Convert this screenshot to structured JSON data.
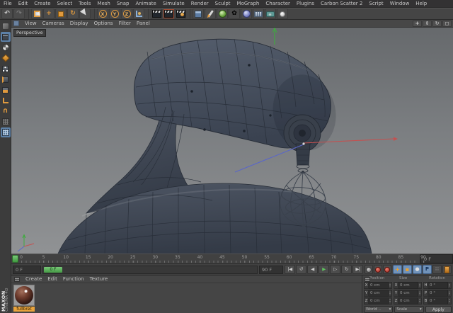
{
  "colors": {
    "accent_orange": "#E09A3E",
    "selection_blue": "#6D8FB5",
    "viewport_top": "#66696C",
    "viewport_bottom": "#909294",
    "model_fill": "#3E4652",
    "wireframe": "#272D37",
    "axis_x_red": "#C45050",
    "axis_y_green": "#3FAA3F",
    "axis_z_blue": "#5A66C8",
    "timeline_green": "#57A957",
    "material_label_orange": "#E8A33C"
  },
  "menu_bar": {
    "items": [
      "File",
      "Edit",
      "Create",
      "Select",
      "Tools",
      "Mesh",
      "Snap",
      "Animate",
      "Simulate",
      "Render",
      "Sculpt",
      "MoGraph",
      "Character",
      "Plugins",
      "Carbon Scatter 2",
      "Script",
      "Window",
      "Help"
    ]
  },
  "toolbar": {
    "items": [
      {
        "n": "undo-button",
        "g": "↶",
        "cls": "ic-light ic-b"
      },
      {
        "n": "redo-button",
        "g": "↷",
        "cls": "ic-dim ic-b"
      },
      {
        "sep": true
      },
      {
        "n": "live-selection-tool",
        "s": "sel"
      },
      {
        "n": "move-tool",
        "g": "+",
        "cls": "ic-orange ic-b"
      },
      {
        "n": "scale-tool",
        "s": "scale"
      },
      {
        "n": "rotate-tool",
        "g": "↻",
        "cls": "ic-orange ic-b"
      },
      {
        "n": "last-used-tool",
        "s": "cursor"
      },
      {
        "sep": true
      },
      {
        "n": "lock-x-axis-button",
        "s": "chip",
        "t": "X"
      },
      {
        "n": "lock-y-axis-button",
        "s": "chip",
        "t": "Y"
      },
      {
        "n": "lock-z-axis-button",
        "s": "chip",
        "t": "Z"
      },
      {
        "n": "coordinate-system-button",
        "s": "coordsys"
      },
      {
        "sep": true
      },
      {
        "n": "render-view-button",
        "s": "clap"
      },
      {
        "n": "render-active-view-button",
        "s": "clap s-clap-act"
      },
      {
        "n": "render-settings-button",
        "s": "clap s-clap-ball"
      },
      {
        "sep": true
      },
      {
        "n": "add-primitive-button",
        "s": "cube3d"
      },
      {
        "n": "add-spline-button",
        "s": "pen"
      },
      {
        "n": "add-generator-button",
        "s": "ballgreen"
      },
      {
        "n": "add-deformer-button",
        "g": "✿",
        "cls": "ic-b"
      },
      {
        "n": "add-environment-button",
        "s": "ballblue"
      },
      {
        "n": "add-floor-button",
        "s": "floor"
      },
      {
        "n": "add-camera-button",
        "s": "cam"
      },
      {
        "n": "add-light-button",
        "s": "bulb"
      }
    ]
  },
  "left_toolbar": {
    "items": [
      {
        "n": "make-editable-button",
        "s": "editable"
      },
      {
        "n": "model-mode-button",
        "s": "cube-dark",
        "active": true
      },
      {
        "n": "texture-mode-button",
        "s": "ball-check"
      },
      {
        "n": "workplane-mode-button",
        "s": "diamond"
      },
      {
        "n": "points-mode-button",
        "s": "cube-points"
      },
      {
        "n": "edges-mode-button",
        "s": "cube-edge"
      },
      {
        "n": "polygons-mode-button",
        "s": "cube-face"
      },
      {
        "n": "enable-axis-button",
        "s": "axisl"
      },
      {
        "n": "soft-selection-button",
        "g": "∩",
        "cls": "ic-orange ic-b"
      },
      {
        "n": "snap-enable-button",
        "s": "grid-dark"
      },
      {
        "n": "workplane-snap-button",
        "s": "grid-blue",
        "active": true
      }
    ]
  },
  "viewport": {
    "menu": [
      "View",
      "Cameras",
      "Display",
      "Options",
      "Filter",
      "Panel"
    ],
    "view_label": "Perspective",
    "controls": [
      {
        "n": "pan-view-button",
        "g": "+",
        "cls": "ic-light ic-b"
      },
      {
        "n": "zoom-view-button",
        "g": "⇕",
        "cls": "ic-light"
      },
      {
        "n": "rotate-view-button",
        "g": "↻",
        "cls": "ic-light"
      },
      {
        "n": "toggle-view-button",
        "g": "◻",
        "cls": "ic-light"
      }
    ]
  },
  "timeline": {
    "ticks": [
      "0",
      "5",
      "10",
      "15",
      "20",
      "25",
      "30",
      "35",
      "40",
      "45",
      "50",
      "55",
      "60",
      "65",
      "70",
      "75",
      "80",
      "85",
      "90"
    ],
    "current_frame": "0 F",
    "range_start": "0 F",
    "range_end": "90 F",
    "handle_label": "0 F"
  },
  "transport": {
    "buttons": [
      {
        "n": "goto-start-button",
        "g": "|◀"
      },
      {
        "n": "play-to-previous-key-button",
        "g": "↺"
      },
      {
        "n": "previous-frame-button",
        "g": "◀"
      },
      {
        "n": "play-button",
        "g": "▶",
        "cls": "green"
      },
      {
        "n": "next-frame-button",
        "g": "▷"
      },
      {
        "n": "play-to-next-key-button",
        "g": "↻"
      },
      {
        "n": "goto-end-button",
        "g": "▶|"
      }
    ],
    "record": [
      {
        "n": "record-keyframe-button",
        "s": "rec-gray"
      },
      {
        "n": "record-active-objects-button",
        "s": "rec-red"
      },
      {
        "n": "autokeying-button",
        "s": "rec-red"
      }
    ],
    "toggles": [
      {
        "n": "key-position-toggle",
        "g": "+",
        "cls": "ko",
        "active": true
      },
      {
        "n": "key-scale-toggle",
        "g": "▪",
        "cls": "ko",
        "active": true
      },
      {
        "n": "key-rotation-toggle",
        "g": "●",
        "cls": "kg",
        "active": true
      },
      {
        "n": "key-parameter-toggle",
        "g": "P",
        "cls": "kb",
        "active": true
      },
      {
        "n": "key-pla-toggle",
        "g": "∷",
        "cls": "kg"
      },
      {
        "n": "keyframe-selection-button",
        "s": "orangedoc"
      }
    ]
  },
  "material_manager": {
    "menu": [
      "Create",
      "Edit",
      "Function",
      "Texture"
    ],
    "materials": [
      {
        "name": "fullbret",
        "selected": true
      }
    ]
  },
  "brand": {
    "maxon": "MAXON",
    "cinema": "CINEMA 4D"
  },
  "coordinates": {
    "columns": [
      {
        "header": "Position",
        "rows": [
          {
            "label": "X",
            "value": "0 cm"
          },
          {
            "label": "Y",
            "value": "0 cm"
          },
          {
            "label": "Z",
            "value": "0 cm"
          }
        ]
      },
      {
        "header": "Size",
        "rows": [
          {
            "label": "X",
            "value": "0 cm"
          },
          {
            "label": "Y",
            "value": "0 cm"
          },
          {
            "label": "Z",
            "value": "0 cm"
          }
        ]
      },
      {
        "header": "Rotation",
        "rows": [
          {
            "label": "H",
            "value": "0 °"
          },
          {
            "label": "P",
            "value": "0 °"
          },
          {
            "label": "B",
            "value": "0 °"
          }
        ]
      }
    ],
    "footer": {
      "left_dropdown": "World ..",
      "mid_dropdown": "Scale",
      "apply_button": "Apply"
    }
  }
}
